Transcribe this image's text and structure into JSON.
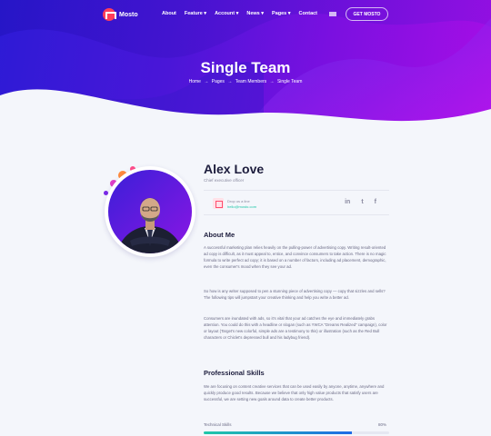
{
  "brand": {
    "name": "Mosto"
  },
  "nav": {
    "items": [
      "About",
      "Feature",
      "Account",
      "News",
      "Pages",
      "Contact"
    ],
    "dropdown": [
      false,
      true,
      true,
      true,
      true,
      false
    ],
    "cta": "GET MOSTO"
  },
  "hero": {
    "title": "Single Team",
    "breadcrumb": [
      "Home",
      "Pages",
      "Team Members",
      "Single Team"
    ]
  },
  "profile": {
    "name": "Alex Love",
    "role": "Chief executive officer",
    "contact_line1": "Drop us a line",
    "contact_line2": "hello@mosto.com",
    "socials": [
      "in",
      "t",
      "f"
    ]
  },
  "about": {
    "heading": "About Me",
    "paragraphs": [
      "A successful marketing plan relies heavily on the pulling-power of advertising copy. Writing result-oriented ad copy is difficult, as it must appeal to, entice, and convince consumers to take action. There is no magic formula to write perfect ad copy; it is based on a number of factors, including ad placement, demographic, even the consumer's mood when they see your ad.",
      "So how is any writer supposed to pen a stunning piece of advertising copy — copy that sizzles and sells? The following tips will jumpstart your creative thinking and help you write a better ad.",
      "Consumers are inundated with ads, so it's vital that your ad catches the eye and immediately grabs attention. You could do this with a headline or slogan (such as YWCA \"Dreams Realized\" campaign), color or layout (Target's new colorful, simple ads are a testimony to this) or illustration (such as the Red Bull characters or Chiclet's depressed bull and his ladybug friend)."
    ]
  },
  "skills": {
    "heading": "Professional Skills",
    "paragraph": "We are focusing on content creative services that can be used easily by anyone, anytime, anywhere and quickly produce good results. Because we believe that only high value products that satisfy users are successful, we are setting new goals around data to create better products.",
    "items": [
      {
        "label": "Technical Skills",
        "value": "80%"
      }
    ]
  },
  "colors": {
    "hero_start": "#2d1bd6",
    "hero_end": "#a80ee6",
    "accent_red": "#ff3d5a",
    "accent_teal": "#1fc7a8"
  }
}
